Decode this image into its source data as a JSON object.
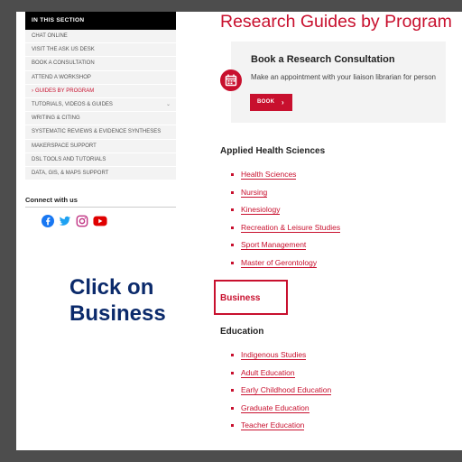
{
  "sidebar": {
    "heading": "IN THIS SECTION",
    "items": [
      {
        "label": "CHAT ONLINE"
      },
      {
        "label": "VISIT THE ASK US DESK"
      },
      {
        "label": "BOOK A CONSULTATION"
      },
      {
        "label": "ATTEND A WORKSHOP"
      },
      {
        "label": "GUIDES BY PROGRAM",
        "active": true
      },
      {
        "label": "TUTORIALS, VIDEOS & GUIDES",
        "expandable": true
      },
      {
        "label": "WRITING & CITING"
      },
      {
        "label": "SYSTEMATIC REVIEWS & EVIDENCE SYNTHESES"
      },
      {
        "label": "MAKERSPACE SUPPORT"
      },
      {
        "label": "DSL TOOLS AND TUTORIALS"
      },
      {
        "label": "DATA, GIS, & MAPS SUPPORT"
      }
    ],
    "active_marker": "›",
    "expand_marker": "⌄"
  },
  "connect": {
    "title": "Connect with us",
    "icons": [
      "facebook-icon",
      "twitter-icon",
      "instagram-icon",
      "youtube-icon"
    ]
  },
  "main": {
    "title": "Research Guides by Program",
    "consultation": {
      "title": "Book a Research Consultation",
      "description": "Make an appointment with your liaison librarian for person",
      "button_label": "BOOK",
      "button_arrow": "›",
      "icon": "calendar-icon"
    },
    "applied_health": {
      "heading": "Applied Health Sciences",
      "links": [
        "Health Sciences",
        "Nursing",
        "Kinesiology",
        "Recreation & Leisure Studies",
        "Sport Management",
        "Master of Gerontology"
      ]
    },
    "business": {
      "label": "Business"
    },
    "education": {
      "heading": "Education",
      "links": [
        "Indigenous Studies",
        "Adult Education",
        "Early Childhood Education",
        "Graduate Education",
        "Teacher Education"
      ]
    }
  },
  "instruction": {
    "line1": "Click on",
    "line2": "Business"
  },
  "colors": {
    "accent": "#c8102e",
    "instruction": "#0b2a6b",
    "backdrop": "#4d4d4d"
  }
}
